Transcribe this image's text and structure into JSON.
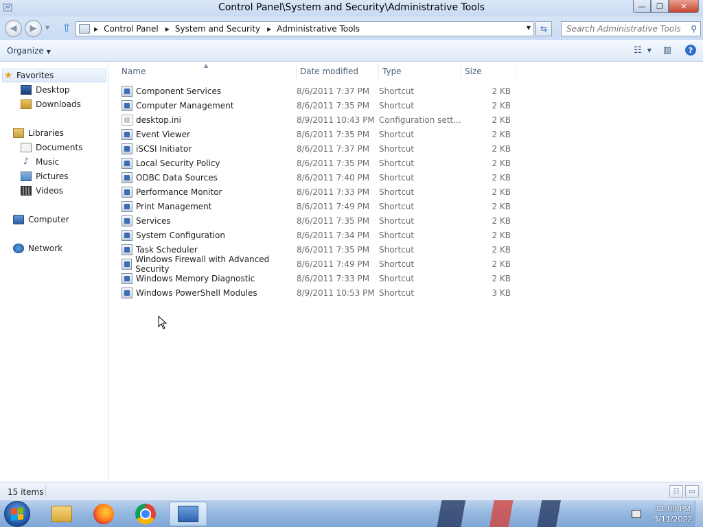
{
  "window": {
    "title": "Control Panel\\System and Security\\Administrative Tools",
    "buttons": {
      "minimize": "—",
      "maximize": "❐",
      "close": "✕"
    }
  },
  "nav": {
    "back_icon": "back-arrow-icon",
    "forward_icon": "forward-arrow-icon",
    "breadcrumbs": [
      "Control Panel",
      "System and Security",
      "Administrative Tools"
    ],
    "search_placeholder": "Search Administrative Tools"
  },
  "toolbar": {
    "organize_label": "Organize"
  },
  "sidebar": {
    "favorites": {
      "label": "Favorites",
      "items": [
        "Desktop",
        "Downloads"
      ]
    },
    "libraries": {
      "label": "Libraries",
      "items": [
        "Documents",
        "Music",
        "Pictures",
        "Videos"
      ]
    },
    "computer": "Computer",
    "network": "Network"
  },
  "columns": [
    "Name",
    "Date modified",
    "Type",
    "Size"
  ],
  "files": [
    {
      "name": "Component Services",
      "date": "8/6/2011 7:37 PM",
      "type": "Shortcut",
      "size": "2 KB"
    },
    {
      "name": "Computer Management",
      "date": "8/6/2011 7:35 PM",
      "type": "Shortcut",
      "size": "2 KB"
    },
    {
      "name": "desktop.ini",
      "date": "8/9/2011 10:43 PM",
      "type": "Configuration sett...",
      "size": "2 KB"
    },
    {
      "name": "Event Viewer",
      "date": "8/6/2011 7:35 PM",
      "type": "Shortcut",
      "size": "2 KB"
    },
    {
      "name": "iSCSI Initiator",
      "date": "8/6/2011 7:37 PM",
      "type": "Shortcut",
      "size": "2 KB"
    },
    {
      "name": "Local Security Policy",
      "date": "8/6/2011 7:35 PM",
      "type": "Shortcut",
      "size": "2 KB"
    },
    {
      "name": "ODBC Data Sources",
      "date": "8/6/2011 7:40 PM",
      "type": "Shortcut",
      "size": "2 KB"
    },
    {
      "name": "Performance Monitor",
      "date": "8/6/2011 7:33 PM",
      "type": "Shortcut",
      "size": "2 KB"
    },
    {
      "name": "Print Management",
      "date": "8/6/2011 7:49 PM",
      "type": "Shortcut",
      "size": "2 KB"
    },
    {
      "name": "Services",
      "date": "8/6/2011 7:35 PM",
      "type": "Shortcut",
      "size": "2 KB"
    },
    {
      "name": "System Configuration",
      "date": "8/6/2011 7:34 PM",
      "type": "Shortcut",
      "size": "2 KB"
    },
    {
      "name": "Task Scheduler",
      "date": "8/6/2011 7:35 PM",
      "type": "Shortcut",
      "size": "2 KB"
    },
    {
      "name": "Windows Firewall with Advanced Security",
      "date": "8/6/2011 7:49 PM",
      "type": "Shortcut",
      "size": "2 KB"
    },
    {
      "name": "Windows Memory Diagnostic",
      "date": "8/6/2011 7:33 PM",
      "type": "Shortcut",
      "size": "2 KB"
    },
    {
      "name": "Windows PowerShell Modules",
      "date": "8/9/2011 10:53 PM",
      "type": "Shortcut",
      "size": "3 KB"
    }
  ],
  "status": {
    "item_count": "15 items"
  },
  "taskbar": {
    "apps": [
      "windows-explorer",
      "firefox",
      "chrome",
      "control-panel"
    ],
    "clock_time": "11:08 PM",
    "clock_date": "3/11/2022"
  }
}
